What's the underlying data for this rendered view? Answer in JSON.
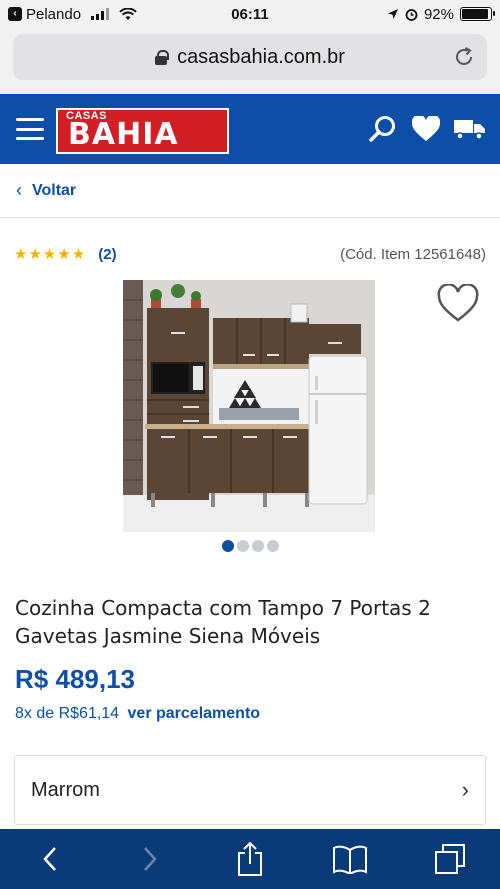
{
  "status_bar": {
    "carrier": "Pelando",
    "time": "06:11",
    "battery": "92%",
    "battery_level": 0.92
  },
  "browser": {
    "url": "casasbahia.com.br"
  },
  "header": {
    "logo_top": "CASAS",
    "logo_main": "BAHIA"
  },
  "nav": {
    "back_label": "Voltar"
  },
  "product": {
    "rating_stars": "★★★★★",
    "review_count": "(2)",
    "item_code": "(Cód. Item 12561648)",
    "title": "Cozinha Compacta com Tampo 7 Portas 2 Gavetas Jasmine Siena Móveis",
    "price": "R$ 489,13",
    "installments_text": "8x de R$61,14",
    "installments_link": "ver parcelamento",
    "variant": "Marrom",
    "carousel_total": 4,
    "carousel_active": 1
  },
  "colors": {
    "brand_blue": "#0d4fa8",
    "brand_red": "#d21f26",
    "star": "#f5b301",
    "toolbar": "#0b3a78"
  },
  "icons": [
    "menu-icon",
    "search-icon",
    "heart-icon",
    "truck-icon",
    "chevron-left-icon",
    "favorite-heart-icon",
    "chevron-right-icon",
    "share-icon",
    "bookmarks-icon",
    "tabs-icon"
  ]
}
